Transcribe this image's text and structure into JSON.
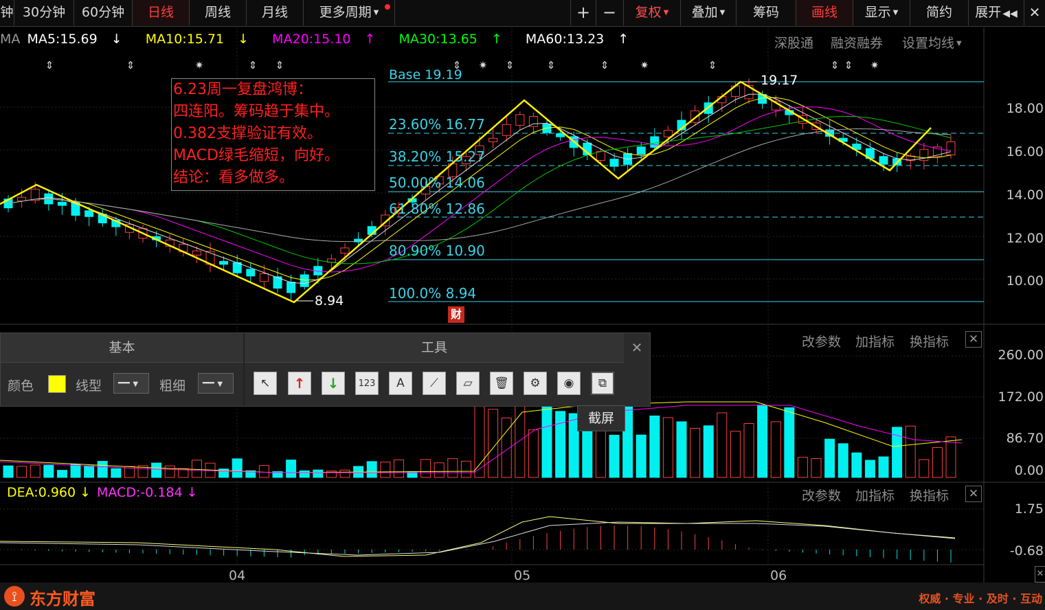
{
  "toolbar": {
    "periods": [
      "钟",
      "30分钟",
      "60分钟",
      "日线",
      "周线",
      "月线",
      "更多周期"
    ],
    "active_period": "日线",
    "right_buttons": [
      "+",
      "−",
      "复权",
      "叠加",
      "筹码",
      "画线",
      "显示",
      "简约",
      "展开"
    ]
  },
  "ma_row": {
    "prefix": "MA",
    "items": [
      {
        "text": "MA5:15.69",
        "arrow": "↓",
        "color": "#ffffff"
      },
      {
        "text": "MA10:15.71",
        "arrow": "↓",
        "color": "#ffff00"
      },
      {
        "text": "MA20:15.10",
        "arrow": "↑",
        "color": "#ff00ff"
      },
      {
        "text": "MA30:13.65",
        "arrow": "↑",
        "color": "#00ff00"
      },
      {
        "text": "MA60:13.23",
        "arrow": "↑",
        "color": "#ffffff"
      }
    ],
    "links": [
      "深股通",
      "融资融券",
      "设置均线"
    ]
  },
  "price_axis": [
    "18.00",
    "16.00",
    "14.00",
    "12.00",
    "10.00"
  ],
  "fib_levels": [
    {
      "text": "Base 19.19"
    },
    {
      "text": "23.60% 16.77"
    },
    {
      "text": "38.20% 15.27"
    },
    {
      "text": "50.00% 14.06"
    },
    {
      "text": "61.80% 12.86"
    },
    {
      "text": "80.90% 10.90"
    },
    {
      "text": "100.0% 8.94"
    }
  ],
  "price_marks": {
    "high": "19.17",
    "low": "8.94"
  },
  "note": {
    "lines": [
      "6.23周一复盘鸿博：",
      "四连阳。筹码趋于集中。",
      "0.382支撑验证有效。",
      "MACD绿毛缩短，向好。",
      "结论：看多做多。"
    ]
  },
  "finance_badge": "财",
  "toolbox": {
    "tab_basic": "基本",
    "tab_tools": "工具",
    "color_label": "颜色",
    "color_value": "#ffff00",
    "line_type_label": "线型",
    "thickness_label": "粗细",
    "tooltip": "截屏"
  },
  "volume_panel": {
    "links": [
      "改参数",
      "加指标",
      "换指标"
    ],
    "axis": [
      "260.00",
      "172.00",
      "86.70",
      "0.00"
    ]
  },
  "macd_panel": {
    "dea": "DEA:0.960",
    "dea_arrow": "↓",
    "macd": "MACD:-0.184",
    "macd_arrow": "↓",
    "links": [
      "改参数",
      "加指标",
      "换指标"
    ],
    "axis": [
      "1.75",
      "-0.68"
    ]
  },
  "months": [
    "04",
    "05",
    "06"
  ],
  "footer": {
    "brand": "东方财富",
    "slogan": "权威 · 专业 · 及时 · 互动"
  }
}
